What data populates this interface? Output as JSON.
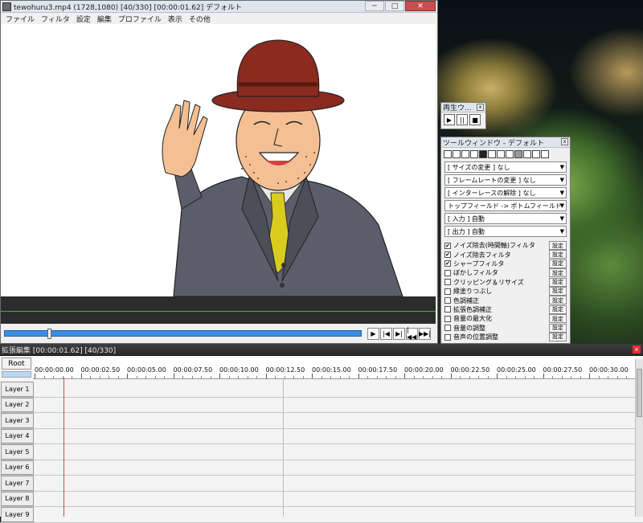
{
  "main_window": {
    "title": "tewohuru3.mp4 (1728,1080)  [40/330]  [00:00:01.62]  デフォルト",
    "menu": [
      "ファイル",
      "フィルタ",
      "設定",
      "編集",
      "プロファイル",
      "表示",
      "その他"
    ],
    "window_buttons": {
      "minimize": "─",
      "maximize": "□",
      "close": "✕"
    },
    "seek_position": 0.12,
    "nav_buttons": [
      "▶",
      "|◀",
      "▶|",
      "|◀◀",
      "▶▶|"
    ]
  },
  "play_window": {
    "title": "再生ウ...",
    "close": "x",
    "buttons": [
      "▶",
      "||",
      "■"
    ]
  },
  "tool_window": {
    "title": "ツールウィンドウ - デフォルト",
    "close": "x",
    "icons": [
      "resize-icon",
      "crop-icon",
      "rotate-icon",
      "flip-icon",
      "black-icon",
      "gray-icon",
      "lines-icon",
      "lines2-icon",
      "fill-icon",
      "auto-icon",
      "marker-icon",
      "delete-icon"
    ],
    "selects": [
      "[ サイズの変更 ] なし",
      "[ フレームレートの変更 ] なし",
      "[ インターレースの解除 ] なし",
      "トップフィールド -> ボトムフィールド",
      "[ 入力 ] 自動",
      "[ 出力 ] 自動"
    ],
    "filters": [
      {
        "label": "ノイズ除去(時間軸)フィルタ",
        "checked": true
      },
      {
        "label": "ノイズ除去フィルタ",
        "checked": true
      },
      {
        "label": "シャープフィルタ",
        "checked": true
      },
      {
        "label": "ぼかしフィルタ",
        "checked": false
      },
      {
        "label": "クリッピング＆リサイズ",
        "checked": false
      },
      {
        "label": "縁塗りつぶし",
        "checked": false
      },
      {
        "label": "色調補正",
        "checked": false
      },
      {
        "label": "拡張色調補正",
        "checked": false
      },
      {
        "label": "音量の最大化",
        "checked": false
      },
      {
        "label": "音量の調整",
        "checked": false
      },
      {
        "label": "音声の位置調整",
        "checked": false
      }
    ],
    "setting_label": "設定",
    "check_mark": "✔"
  },
  "timeline": {
    "title": "拡張編集 [00:00:01.62] [40/330]",
    "close": "x",
    "root": "Root",
    "ticks": [
      "00:00:00.00",
      "00:00:02.50",
      "00:00:05.00",
      "00:00:07.50",
      "00:00:10.00",
      "00:00:12.50",
      "00:00:15.00",
      "00:00:17.50",
      "00:00:20.00",
      "00:00:22.50",
      "00:00:25.00",
      "00:00:27.50",
      "00:00:30.00"
    ],
    "layers": [
      "Layer 1",
      "Layer 2",
      "Layer 3",
      "Layer 4",
      "Layer 5",
      "Layer 6",
      "Layer 7",
      "Layer 8",
      "Layer 9"
    ]
  },
  "colors": {
    "seekbar": "#3a8fe6",
    "cursor": "#e04040",
    "hat": "#8b2a1f",
    "suit": "#5b5e6a",
    "tie": "#d9cc1e",
    "skin": "#f4bf92"
  }
}
